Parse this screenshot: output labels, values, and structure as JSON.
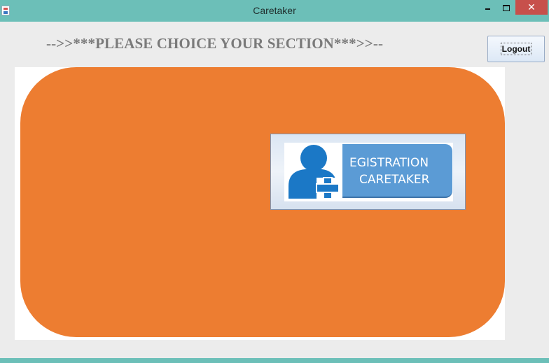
{
  "window": {
    "title": "Caretaker",
    "close_glyph": "✕",
    "icons": [
      "java-app-icon",
      "minimize-icon",
      "maximize-icon",
      "close-icon"
    ]
  },
  "header": {
    "heading": "-->>***PLEASE CHOICE YOUR SECTION***>>--",
    "logout_label": "Logout"
  },
  "registration": {
    "line1": "EGISTRATION",
    "line2": "CARETAKER",
    "icon": "add-user-icon"
  },
  "colors": {
    "titlebar": "#6cbfb8",
    "panel_orange": "#ed7d31",
    "registration_blue": "#5b9bd5",
    "close_red": "#c7504b",
    "heading_gray": "#7a7a7a"
  }
}
